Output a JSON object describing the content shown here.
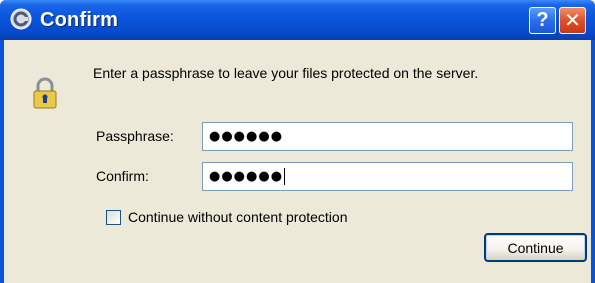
{
  "window": {
    "title": "Confirm",
    "help_glyph": "?",
    "close_glyph": "✕"
  },
  "dialog": {
    "message": "Enter a passphrase to leave your files protected on the server.",
    "passphrase_label": "Passphrase:",
    "passphrase_value": "●●●●●●",
    "confirm_label": "Confirm:",
    "confirm_value": "●●●●●●",
    "checkbox_label": "Continue without content protection",
    "checkbox_checked": false,
    "continue_label": "Continue"
  },
  "icons": {
    "app": "app-logo-icon",
    "lock": "padlock-icon",
    "help": "help-icon",
    "close": "close-icon"
  },
  "colors": {
    "titlebar": "#0a55dc",
    "client_bg": "#ece9d8",
    "close_button": "#e0502a",
    "field_border": "#7f9db9"
  }
}
